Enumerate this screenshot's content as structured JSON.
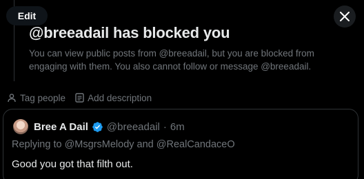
{
  "toolbar": {
    "edit_label": "Edit"
  },
  "blocked_notice": {
    "title": "@breeadail has blocked you",
    "description": "You can view public posts from @breeadail, but you are blocked from engaging with them. You also cannot follow or message @breeadail."
  },
  "meta_actions": {
    "tag_people": "Tag people",
    "add_description": "Add description"
  },
  "quoted_post": {
    "author_name": "Bree A Dail",
    "handle": "@breeadail",
    "separator": "·",
    "time": "6m",
    "replying_prefix": "Replying to",
    "mention_1": "@MsgrsMelody",
    "conjunction": "and",
    "mention_2": "@RealCandaceO",
    "body": "Good you got that filth out."
  },
  "colors": {
    "background": "#000000",
    "primary_text": "#e7e9ea",
    "secondary_text": "#71767b",
    "border": "#2f3336",
    "verified_badge": "#1d9bf0"
  },
  "icons": {
    "close": "close-icon",
    "tag": "person-icon",
    "description": "document-icon",
    "verified": "verified-badge-icon"
  }
}
